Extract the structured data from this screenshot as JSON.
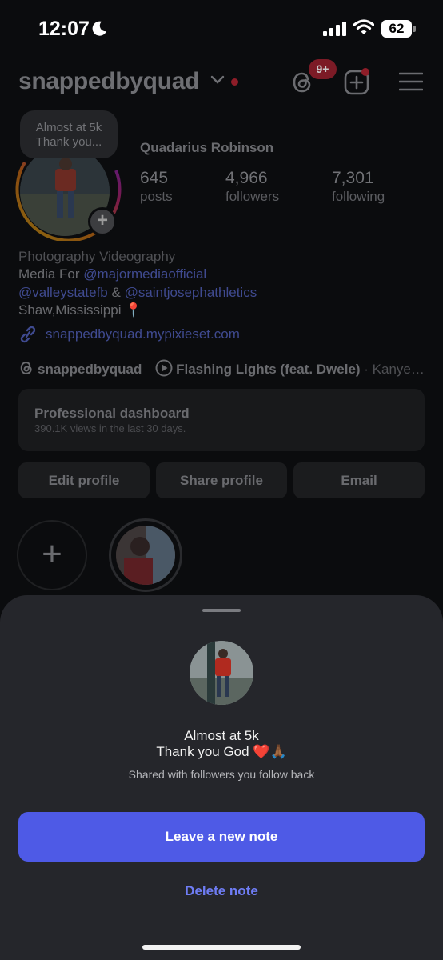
{
  "status_bar": {
    "time": "12:07",
    "battery": "62"
  },
  "header": {
    "username": "snappedbyquad",
    "threads_badge": "9+"
  },
  "profile": {
    "note_line1": "Almost at 5k",
    "note_line2": "Thank you...",
    "full_name": "Quadarius Robinson",
    "stats": [
      {
        "value": "645",
        "label": "posts"
      },
      {
        "value": "4,966",
        "label": "followers"
      },
      {
        "value": "7,301",
        "label": "following"
      }
    ],
    "bio": {
      "line1": "Photography Videography",
      "line2_prefix": "Media For ",
      "line2_link": "@majormediaofficial",
      "line3_link1": "@valleystatefb",
      "line3_amp": " & ",
      "line3_link2": "@saintjosephathletics",
      "line4": "Shaw,Mississippi",
      "line4_emoji": "📍"
    },
    "website": "snappedbyquad.mypixieset.com",
    "threads_handle": "snappedbyquad",
    "music_title": "Flashing Lights (feat. Dwele)",
    "music_artist": "· Kanye…"
  },
  "dashboard": {
    "title": "Professional dashboard",
    "subtitle": "390.1K views in the last 30 days."
  },
  "buttons": {
    "edit": "Edit profile",
    "share": "Share profile",
    "email": "Email"
  },
  "sheet": {
    "note_line1": "Almost at 5k",
    "note_line2": "Thank you God ❤️🙏🏾",
    "shared": "Shared with followers you follow back",
    "leave": "Leave a new note",
    "delete": "Delete note"
  },
  "colors": {
    "accent": "#4e5ae6",
    "link": "#6f7df5",
    "sheet": "#25262b",
    "badge": "#7c1b26"
  }
}
